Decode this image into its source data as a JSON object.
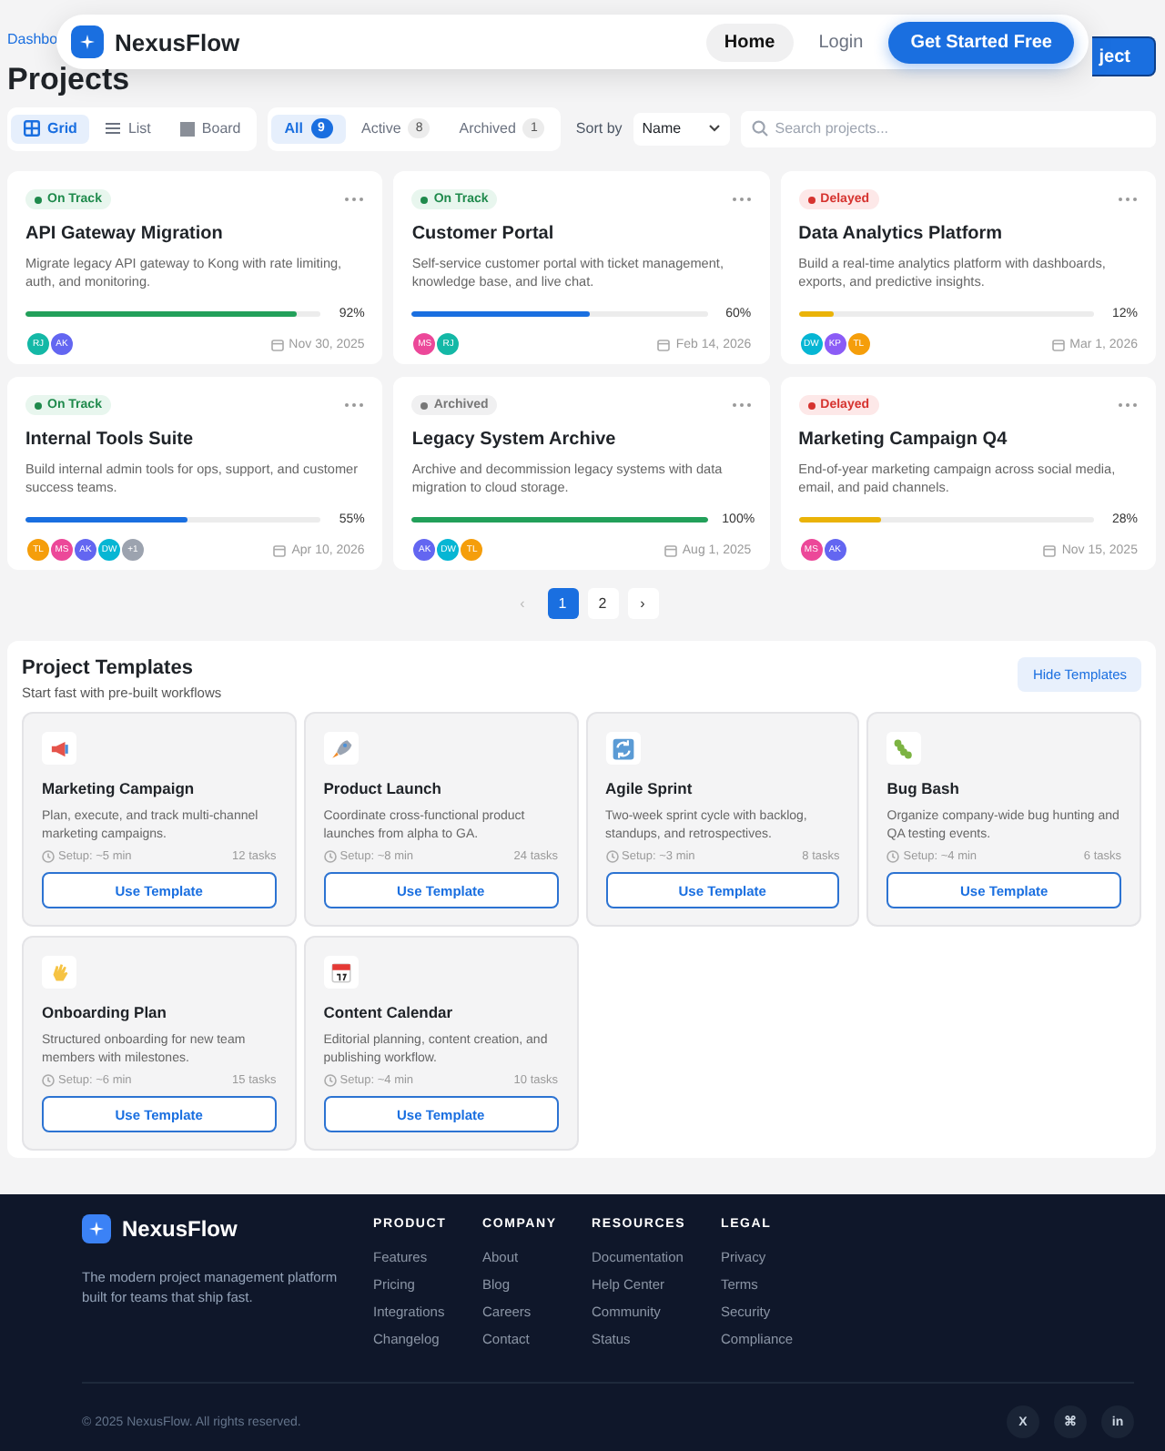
{
  "nav": {
    "brand": "NexusFlow",
    "links": [
      {
        "label": "Home",
        "selected": true
      },
      {
        "label": "Login",
        "selected": false
      }
    ],
    "cta": "Get Started Free"
  },
  "header": {
    "breadcrumb": "Dashbo",
    "title": "Projects",
    "button": "ject"
  },
  "toolbar": {
    "views": [
      {
        "label": "Grid",
        "selected": true
      },
      {
        "label": "List",
        "selected": false
      },
      {
        "label": "Board",
        "selected": false
      }
    ],
    "filters": [
      {
        "label": "All",
        "count": "9",
        "selected": true
      },
      {
        "label": "Active",
        "count": "8",
        "selected": false
      },
      {
        "label": "Archived",
        "count": "1",
        "selected": false
      }
    ],
    "sort_label": "Sort by",
    "sort_value": "Name",
    "search": {
      "placeholder": "Search projects..."
    }
  },
  "projects": [
    {
      "status": "On Track",
      "kind": "on_track",
      "title": "API Gateway Migration",
      "description": "Migrate legacy API gateway to Kong with rate limiting, auth, and monitoring.",
      "level": 0.92,
      "percent": "92%",
      "color": "#22a05a",
      "avatars": [
        {
          "initials": "RJ",
          "color": "#14b8a6"
        },
        {
          "initials": "AK",
          "color": "#6366f1"
        }
      ],
      "date": "Nov 30, 2025"
    },
    {
      "status": "On Track",
      "kind": "on_track",
      "title": "Customer Portal",
      "description": "Self-service customer portal with ticket management, knowledge base, and live chat.",
      "level": 0.6,
      "percent": "60%",
      "color": "#1a6fe0",
      "avatars": [
        {
          "initials": "MS",
          "color": "#ec4899"
        },
        {
          "initials": "RJ",
          "color": "#14b8a6"
        }
      ],
      "date": "Feb 14, 2026"
    },
    {
      "status": "Delayed",
      "kind": "delayed",
      "title": "Data Analytics Platform",
      "description": "Build a real-time analytics platform with dashboards, exports, and predictive insights.",
      "level": 0.12,
      "percent": "12%",
      "color": "#eab308",
      "avatars": [
        {
          "initials": "DW",
          "color": "#06b6d4"
        },
        {
          "initials": "KP",
          "color": "#8b5cf6"
        },
        {
          "initials": "TL",
          "color": "#f59e0b"
        }
      ],
      "date": "Mar 1, 2026"
    },
    {
      "status": "On Track",
      "kind": "on_track",
      "title": "Internal Tools Suite",
      "description": "Build internal admin tools for ops, support, and customer success teams.",
      "level": 0.55,
      "percent": "55%",
      "color": "#1a6fe0",
      "avatars": [
        {
          "initials": "TL",
          "color": "#f59e0b"
        },
        {
          "initials": "MS",
          "color": "#ec4899"
        },
        {
          "initials": "AK",
          "color": "#6366f1"
        },
        {
          "initials": "DW",
          "color": "#06b6d4"
        },
        {
          "initials": "+1",
          "color": "#9ca3af"
        }
      ],
      "date": "Apr 10, 2026"
    },
    {
      "status": "Archived",
      "kind": "archived",
      "title": "Legacy System Archive",
      "description": "Archive and decommission legacy systems with data migration to cloud storage.",
      "level": 1,
      "percent": "100%",
      "color": "#22a05a",
      "avatars": [
        {
          "initials": "AK",
          "color": "#6366f1"
        },
        {
          "initials": "DW",
          "color": "#06b6d4"
        },
        {
          "initials": "TL",
          "color": "#f59e0b"
        }
      ],
      "date": "Aug 1, 2025"
    },
    {
      "status": "Delayed",
      "kind": "delayed",
      "title": "Marketing Campaign Q4",
      "description": "End-of-year marketing campaign across social media, email, and paid channels.",
      "level": 0.28,
      "percent": "28%",
      "color": "#eab308",
      "avatars": [
        {
          "initials": "MS",
          "color": "#ec4899"
        },
        {
          "initials": "AK",
          "color": "#6366f1"
        }
      ],
      "date": "Nov 15, 2025"
    }
  ],
  "pagination": {
    "prev": "‹",
    "pages": [
      {
        "label": "1",
        "selected": true
      },
      {
        "label": "2",
        "selected": false
      }
    ],
    "next": "›"
  },
  "templates": {
    "title": "Project Templates",
    "subtitle": "Start fast with pre-built workflows",
    "toggle": "Hide Templates",
    "items": [
      {
        "title": "Marketing Campaign",
        "description": "Plan, execute, and track multi-channel marketing campaigns.",
        "setup": "Setup: ~5 min",
        "tasks": "12 tasks",
        "button": "Use Template"
      },
      {
        "title": "Product Launch",
        "description": "Coordinate cross-functional product launches from alpha to GA.",
        "setup": "Setup: ~8 min",
        "tasks": "24 tasks",
        "button": "Use Template"
      },
      {
        "title": "Agile Sprint",
        "description": "Two-week sprint cycle with backlog, standups, and retrospectives.",
        "setup": "Setup: ~3 min",
        "tasks": "8 tasks",
        "button": "Use Template"
      },
      {
        "title": "Bug Bash",
        "description": "Organize company-wide bug hunting and QA testing events.",
        "setup": "Setup: ~4 min",
        "tasks": "6 tasks",
        "button": "Use Template"
      },
      {
        "title": "Onboarding Plan",
        "description": "Structured onboarding for new team members with milestones.",
        "setup": "Setup: ~6 min",
        "tasks": "15 tasks",
        "button": "Use Template"
      },
      {
        "title": "Content Calendar",
        "description": "Editorial planning, content creation, and publishing workflow.",
        "setup": "Setup: ~4 min",
        "tasks": "10 tasks",
        "button": "Use Template"
      }
    ]
  },
  "footer": {
    "brand": "NexusFlow",
    "tagline": "The modern project management platform built for teams that ship fast.",
    "columns": [
      {
        "heading": "PRODUCT",
        "links": [
          "Features",
          "Pricing",
          "Integrations",
          "Changelog"
        ]
      },
      {
        "heading": "COMPANY",
        "links": [
          "About",
          "Blog",
          "Careers",
          "Contact"
        ]
      },
      {
        "heading": "RESOURCES",
        "links": [
          "Documentation",
          "Help Center",
          "Community",
          "Status"
        ]
      },
      {
        "heading": "LEGAL",
        "links": [
          "Privacy",
          "Terms",
          "Security",
          "Compliance"
        ]
      }
    ],
    "copyright": "© 2025 NexusFlow. All rights reserved.",
    "social": [
      "X",
      "⌘",
      "in"
    ]
  }
}
